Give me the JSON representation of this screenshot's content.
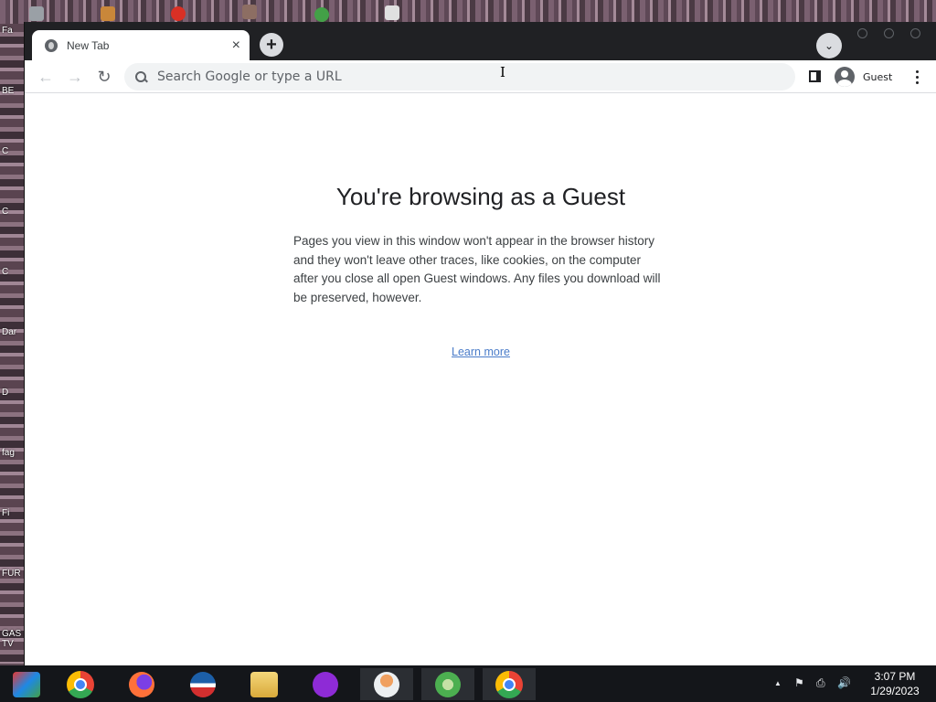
{
  "desktop": {
    "labels": [
      "Fa",
      "BE",
      "C",
      "C",
      "C",
      "Dar",
      "D",
      "fag",
      "Fi",
      "FUR",
      "GAS TV"
    ]
  },
  "browser": {
    "tab": {
      "title": "New Tab",
      "close_glyph": "×"
    },
    "new_tab_glyph": "+",
    "tab_search_glyph": "⌄",
    "toolbar": {
      "back_glyph": "←",
      "forward_glyph": "→",
      "reload_glyph": "↻",
      "omnibox_placeholder": "Search Google or type a URL",
      "profile_label": "Guest"
    },
    "page": {
      "title": "You're browsing as a Guest",
      "description": "Pages you view in this window won't appear in the browser history and they won't leave other traces, like cookies, on the computer after you close all open Guest windows. Any files you download will be preserved, however.",
      "learn_more": "Learn more"
    }
  },
  "taskbar": {
    "apps": [
      {
        "name": "app-launcher-icon",
        "color": "#1a73e8"
      },
      {
        "name": "chrome-icon"
      },
      {
        "name": "firefox-icon",
        "color": "#ff7139"
      },
      {
        "name": "obama-logo-icon",
        "color": "#1c5fa8"
      },
      {
        "name": "file-explorer-icon",
        "color": "#e8c25a"
      },
      {
        "name": "mask-app-icon",
        "color": "#8e2bd6"
      },
      {
        "name": "person-app-icon",
        "color": "#f0a060"
      },
      {
        "name": "green-app-icon",
        "color": "#4caf50"
      },
      {
        "name": "chrome-active-icon"
      }
    ],
    "tray": {
      "chevron": "▲",
      "flag": "⚑",
      "network": "⎙",
      "volume": "🔊"
    },
    "clock": {
      "time": "3:07 PM",
      "date": "1/29/2023"
    }
  }
}
